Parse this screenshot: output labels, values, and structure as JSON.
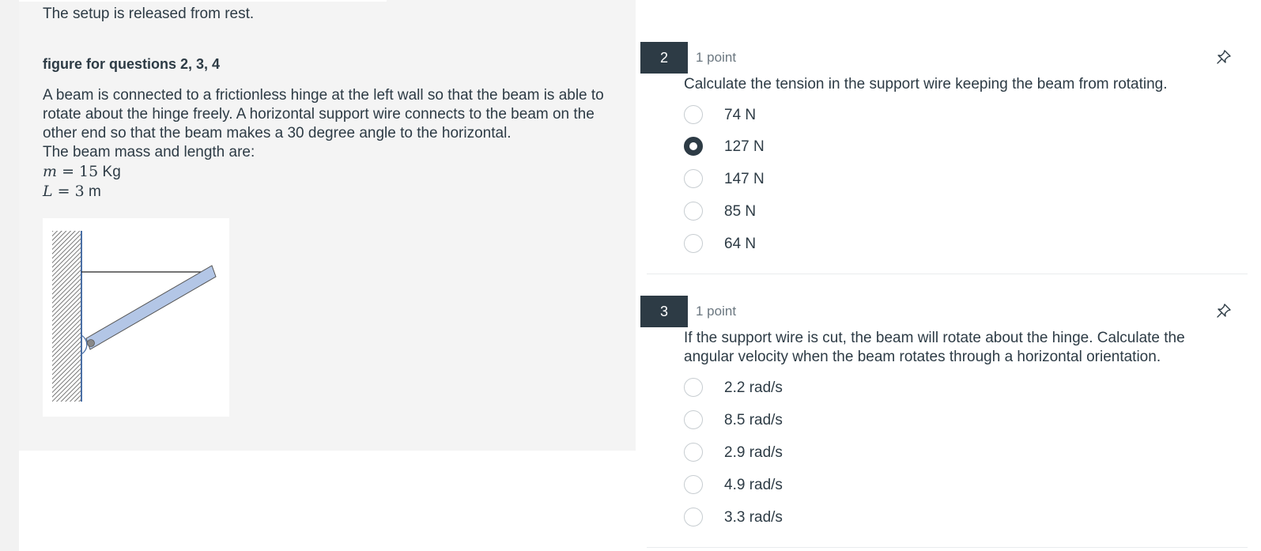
{
  "stimulus": {
    "intro_text": "The setup is released from rest.",
    "figure_title": "figure for questions 2, 3, 4",
    "paragraph": "A beam is connected to a frictionless hinge at the left wall so that the beam is able to rotate about the hinge freely.  A horizontal support wire connects to the beam on the other end so that the beam makes a 30 degree angle to the horizontal.",
    "mass_length_intro": "The beam mass and length are:",
    "mass": {
      "symbol": "m",
      "equals": "=",
      "value": "15",
      "unit": "Kg"
    },
    "length": {
      "symbol": "L",
      "equals": "=",
      "value": "3",
      "unit": "m"
    },
    "colors": {
      "background": "#f4f4f4",
      "beam": "#b3c6e6",
      "wall_line": "#4a6fa5"
    }
  },
  "questions": [
    {
      "number": "2",
      "points": "1 point",
      "pin_icon": "pushpin-icon",
      "text": "Calculate the tension in the support wire keeping the beam from rotating.",
      "answers": [
        {
          "label": "74 N",
          "selected": false
        },
        {
          "label": "127 N",
          "selected": true
        },
        {
          "label": "147 N",
          "selected": false
        },
        {
          "label": "85 N",
          "selected": false
        },
        {
          "label": "64 N",
          "selected": false
        }
      ]
    },
    {
      "number": "3",
      "points": "1 point",
      "pin_icon": "pushpin-icon",
      "text": "If the support wire is cut, the beam will rotate about the hinge.  Calculate the angular velocity when the beam rotates through a horizontal orientation.",
      "answers": [
        {
          "label": "2.2 rad/s",
          "selected": false
        },
        {
          "label": "8.5 rad/s",
          "selected": false
        },
        {
          "label": "2.9 rad/s",
          "selected": false
        },
        {
          "label": "4.9 rad/s",
          "selected": false
        },
        {
          "label": "3.3 rad/s",
          "selected": false
        }
      ]
    }
  ],
  "accent_color": "#2d3b45"
}
